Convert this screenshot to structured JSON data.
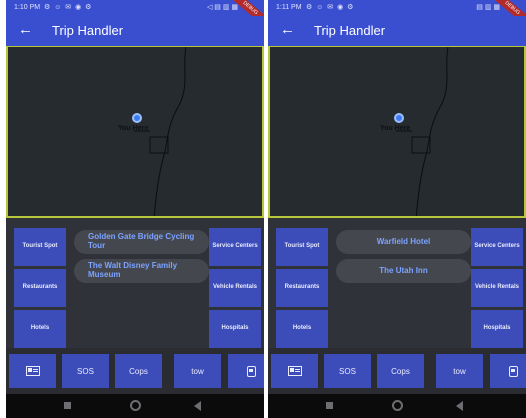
{
  "screens": [
    {
      "status_time": "1:10 PM",
      "status_icons": "⚙ ☺ ✉ ◉ ⚙",
      "status_right": "◁ ▤ ▥ ▦",
      "debug_label": "DEBUG",
      "title": "Trip Handler",
      "marker_label": "You Here",
      "left_buttons": [
        "Tourist Spot",
        "Restaurants",
        "Hotels"
      ],
      "right_buttons": [
        "Service Centers",
        "Vehicle Rentals",
        "Hospitals"
      ],
      "results": [
        "Golden Gate Bridge Cycling Tour",
        "The Walt Disney Family Museum"
      ],
      "bottom": {
        "sos": "SOS",
        "cops": "Cops",
        "tow": "tow"
      }
    },
    {
      "status_time": "1:11 PM",
      "status_icons": "⚙ ☺ ✉ ◉ ⚙",
      "status_right": "▤ ▥ ▦",
      "debug_label": "DEBUG",
      "title": "Trip Handler",
      "marker_label": "You Here",
      "left_buttons": [
        "Tourist Spot",
        "Restaurants",
        "Hotels"
      ],
      "right_buttons": [
        "Service Centers",
        "Vehicle Rentals",
        "Hospitals"
      ],
      "results": [
        "Warfield Hotel",
        "The Utah Inn"
      ],
      "bottom": {
        "sos": "SOS",
        "cops": "Cops",
        "tow": "tow"
      }
    }
  ],
  "icons": {
    "back": "arrow-left",
    "card": "id-card",
    "bus": "bus",
    "nav": [
      "square-back",
      "circle-home",
      "triangle-recent"
    ]
  },
  "colors": {
    "primary": "#3a4fcf",
    "button": "#3c4cb8",
    "pill_text": "#7ba3ff",
    "map_border": "#b7c63a"
  }
}
